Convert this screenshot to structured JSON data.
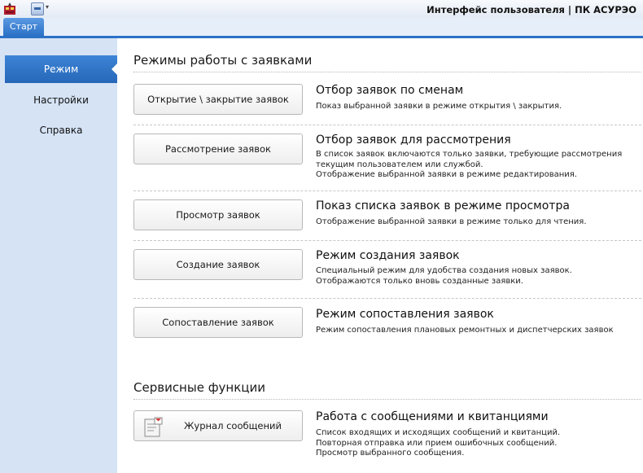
{
  "window": {
    "title": "Интерфейс пользователя | ПК АСУРЭО",
    "qa_dropdown": "▾"
  },
  "ribbon": {
    "tabs": [
      {
        "label": "Старт",
        "active": true
      }
    ]
  },
  "sidebar": {
    "items": [
      {
        "label": "Режим",
        "active": true
      },
      {
        "label": "Настройки",
        "active": false
      },
      {
        "label": "Справка",
        "active": false
      }
    ]
  },
  "sections": [
    {
      "title": "Режимы работы с заявками",
      "items": [
        {
          "button": "Открытие \\ закрытие заявок",
          "title": "Отбор заявок по сменам",
          "desc": [
            "Показ выбранной заявки в режиме открытия \\ закрытия."
          ]
        },
        {
          "button": "Рассмотрение заявок",
          "title": "Отбор заявок для рассмотрения",
          "desc": [
            "В список заявок включаются только заявки, требующие рассмотрения",
            "текущим пользователем или службой.",
            "Отображение выбранной заявки в режиме редактирования."
          ]
        },
        {
          "button": "Просмотр заявок",
          "title": "Показ списка заявок в режиме просмотра",
          "desc": [
            "Отображение выбранной заявки в режиме только для чтения."
          ]
        },
        {
          "button": "Создание заявок",
          "title": "Режим создания заявок",
          "desc": [
            "Специальный режим для удобства создания новых заявок.",
            "Отображаются только вновь созданные заявки."
          ]
        },
        {
          "button": "Сопоставление заявок",
          "title": "Режим сопоставления заявок",
          "desc": [
            "Режим сопоставления плановых ремонтных и диспетчерских заявок"
          ]
        }
      ]
    },
    {
      "title": "Сервисные функции",
      "items": [
        {
          "button": "Журнал сообщений",
          "title": "Работа с сообщениями и квитанциями",
          "desc": [
            "Список входящих и исходящих сообщений и квитанций.",
            "Повторная отправка или прием ошибочных сообщений.",
            "Просмотр выбранного сообщения."
          ]
        }
      ]
    }
  ],
  "colors": {
    "accent": "#2a71c6",
    "sidebar_bg": "#d5e3f5"
  }
}
